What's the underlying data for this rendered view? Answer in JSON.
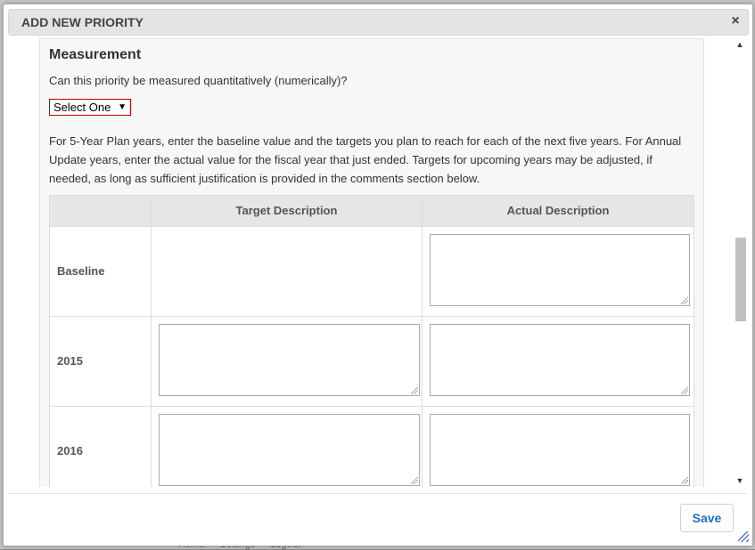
{
  "background": {
    "footer_links": [
      "Home",
      "Settings",
      "Logout"
    ]
  },
  "modal": {
    "title": "ADD NEW PRIORITY",
    "close_icon": "×",
    "save_label": "Save"
  },
  "measurement": {
    "title": "Measurement",
    "question": "Can this priority be measured quantitatively (numerically)?",
    "select_value": "Select One",
    "select_arrow": "▼",
    "instructions": "For 5-Year Plan years, enter the baseline value and the targets you plan to reach for each of the next five years. For Annual Update years, enter the actual value for the fiscal year that just ended. Targets for upcoming years may be adjusted, if needed, as long as sufficient justification is provided in the comments section below."
  },
  "table": {
    "headers": [
      "",
      "Target Description",
      "Actual Description"
    ],
    "rows": [
      {
        "label": "Baseline",
        "has_target": false,
        "target_value": "",
        "actual_value": ""
      },
      {
        "label": "2015",
        "has_target": true,
        "target_value": "",
        "actual_value": ""
      },
      {
        "label": "2016",
        "has_target": true,
        "target_value": "",
        "actual_value": ""
      }
    ]
  },
  "scrollbar": {
    "up_icon": "▲",
    "down_icon": "▼"
  },
  "colors": {
    "accent": "#1d6fc7",
    "select_border": "#c00000",
    "header_bg": "#e4e4e4"
  }
}
